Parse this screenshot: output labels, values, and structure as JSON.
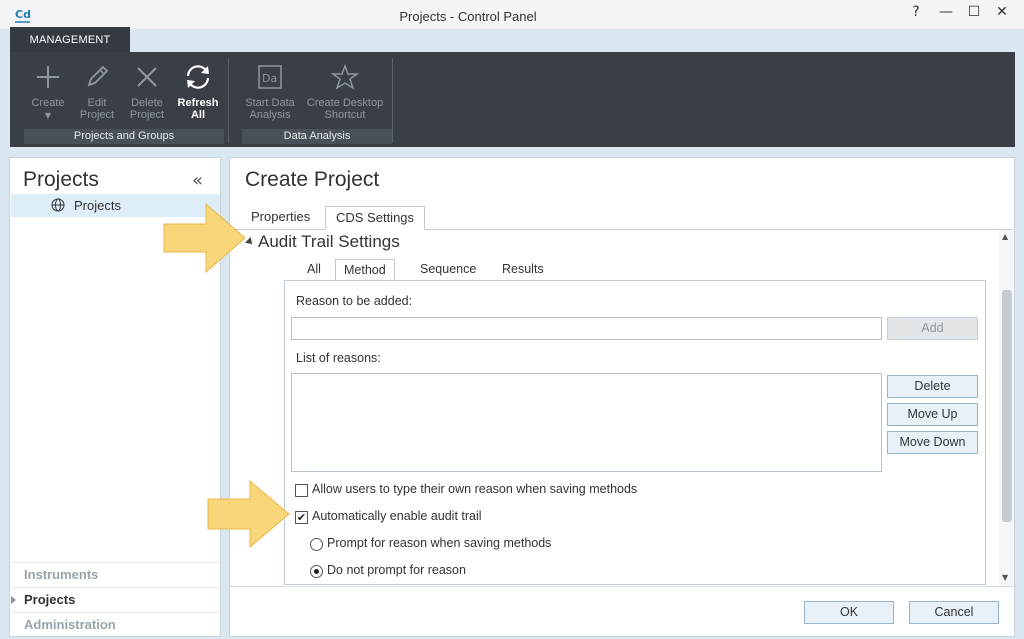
{
  "window": {
    "title": "Projects - Control Panel",
    "logo_text": "Cd",
    "help": "?",
    "minimize": "—",
    "maximize": "☐",
    "close": "✕"
  },
  "ribbon": {
    "tab_label": "MANAGEMENT",
    "groups": [
      {
        "label": "Projects and Groups",
        "buttons": [
          {
            "label": "Create",
            "icon": "plus-icon",
            "enabled": false,
            "has_dropdown": true
          },
          {
            "label": "Edit Project",
            "icon": "pencil-icon",
            "enabled": false
          },
          {
            "label": "Delete Project",
            "icon": "x-icon",
            "enabled": false
          },
          {
            "label": "Refresh All",
            "icon": "refresh-icon",
            "enabled": true
          }
        ]
      },
      {
        "label": "Data Analysis",
        "buttons": [
          {
            "label": "Start Data Analysis",
            "icon": "data-analysis-icon",
            "enabled": false
          },
          {
            "label": "Create Desktop Shortcut",
            "icon": "star-icon",
            "enabled": false
          }
        ]
      }
    ],
    "labels": {
      "create": "Create",
      "edit_1": "Edit",
      "edit_2": "Project",
      "delete_1": "Delete",
      "delete_2": "Project",
      "refresh_1": "Refresh",
      "refresh_2": "All",
      "start_1": "Start Data",
      "start_2": "Analysis",
      "shortcut_1": "Create Desktop",
      "shortcut_2": "Shortcut",
      "group_1": "Projects and Groups",
      "group_2": "Data Analysis",
      "da_icon_text": "Da"
    }
  },
  "left_pane": {
    "title": "Projects",
    "collapse_glyph": "«",
    "tree_item": "Projects",
    "nav": [
      {
        "label": "Instruments",
        "active": false
      },
      {
        "label": "Projects",
        "active": true
      },
      {
        "label": "Administration",
        "active": false
      }
    ]
  },
  "main": {
    "title": "Create Project",
    "tabs": [
      {
        "label": "Properties",
        "selected": false
      },
      {
        "label": "CDS Settings",
        "selected": true
      }
    ],
    "section_title": "Audit Trail Settings",
    "subtabs": [
      {
        "label": "All",
        "selected": false
      },
      {
        "label": "Method",
        "selected": true
      },
      {
        "label": "Sequence",
        "selected": false
      },
      {
        "label": "Results",
        "selected": false
      }
    ],
    "reason_label": "Reason to be added:",
    "reason_value": "",
    "add_button": "Add",
    "list_label": "List of reasons:",
    "list_items": [],
    "delete_button": "Delete",
    "move_up_button": "Move Up",
    "move_down_button": "Move Down",
    "allow_own_reason": {
      "label": "Allow users to type their own reason when saving methods",
      "checked": false
    },
    "auto_enable": {
      "label": "Automatically enable audit trail",
      "checked": true
    },
    "radio_prompt": {
      "label": "Prompt for reason when saving methods",
      "selected": false
    },
    "radio_no_prompt": {
      "label": "Do not prompt for reason",
      "selected": true
    },
    "ok_button": "OK",
    "cancel_button": "Cancel",
    "check_glyph": "✔"
  },
  "colors": {
    "accent": "#1f7bb8",
    "ribbon_bg": "#3a3f45",
    "callout_arrow": "#f9d67a"
  }
}
